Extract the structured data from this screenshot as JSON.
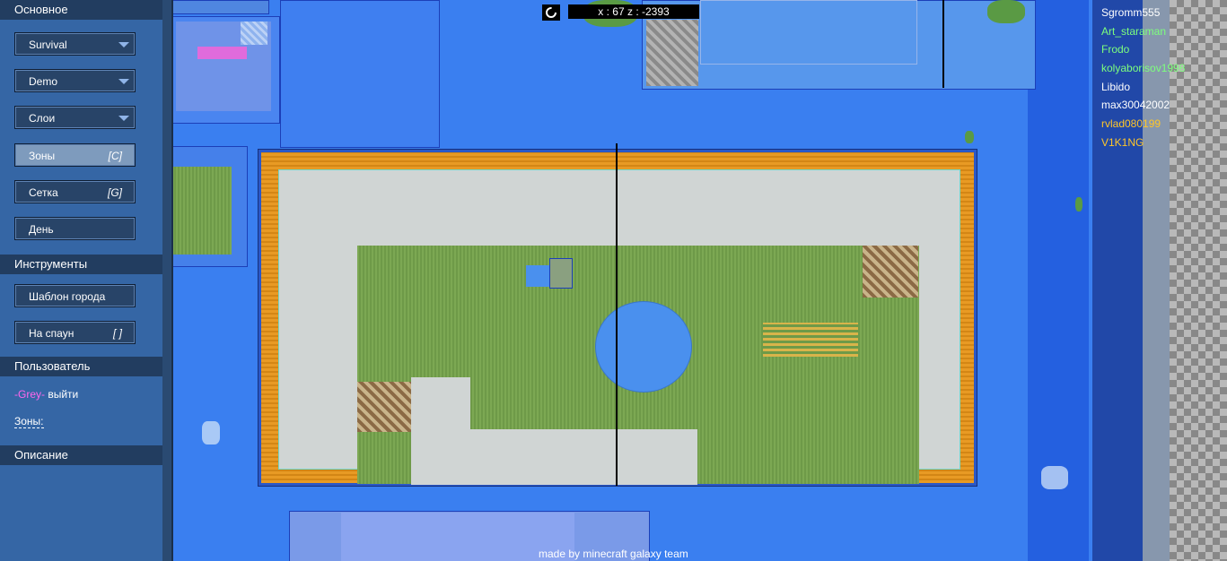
{
  "sections": {
    "main": "Основное",
    "tools": "Инструменты",
    "user": "Пользователь",
    "description": "Описание"
  },
  "main_buttons": [
    {
      "label": "Survival",
      "dropdown": true
    },
    {
      "label": "Demo",
      "dropdown": true
    },
    {
      "label": "Слои",
      "dropdown": true
    },
    {
      "label": "Зоны",
      "hotkey": "[C]",
      "active": true
    },
    {
      "label": "Сетка",
      "hotkey": "[G]"
    },
    {
      "label": "День"
    }
  ],
  "tool_buttons": [
    {
      "label": "Шаблон города"
    },
    {
      "label": "На спаун",
      "hotkey": "[ ]"
    }
  ],
  "user": {
    "name": "-Grey-",
    "logout": "выйти",
    "zones_link": "Зоны:"
  },
  "coords": "x : 67 z : -2393",
  "players": [
    {
      "name": "Sgromm555",
      "color": "#ffffff"
    },
    {
      "name": "Art_staraman",
      "color": "#7dff7d"
    },
    {
      "name": "Frodo",
      "color": "#7dff7d"
    },
    {
      "name": "kolyaborisov1998",
      "color": "#7dff7d"
    },
    {
      "name": "Libido",
      "color": "#ffffff"
    },
    {
      "name": "max30042002",
      "color": "#ffffff"
    },
    {
      "name": "rvlad080199",
      "color": "#ffc629"
    },
    {
      "name": "V1K1NG",
      "color": "#ffc629"
    }
  ],
  "footer": "made by minecraft galaxy team",
  "icons": {
    "reload": "reload-icon",
    "dropdown": "chevron-down-icon"
  }
}
